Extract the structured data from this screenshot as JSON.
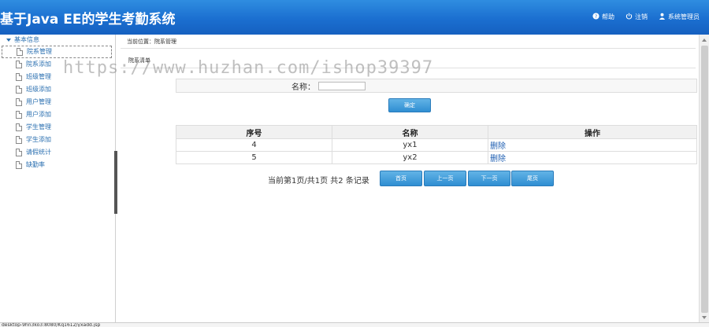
{
  "header": {
    "title": "基于Java EE的学生考勤系统",
    "nav": [
      {
        "label": "帮助",
        "icon": "help-icon"
      },
      {
        "label": "注销",
        "icon": "power-icon"
      },
      {
        "label": "系统管理员",
        "icon": "user-icon"
      }
    ]
  },
  "sidebar": {
    "section_label": "基本信息",
    "items": [
      {
        "label": "院系管理"
      },
      {
        "label": "院系添加"
      },
      {
        "label": "班级管理"
      },
      {
        "label": "班级添加"
      },
      {
        "label": "用户管理"
      },
      {
        "label": "用户添加"
      },
      {
        "label": "学生管理"
      },
      {
        "label": "学生添加"
      },
      {
        "label": "请假统计"
      },
      {
        "label": "缺勤率"
      }
    ]
  },
  "main": {
    "breadcrumb": "当前位置：院系管理",
    "list_tab": "院系清单",
    "search": {
      "label": "名称：",
      "value": ""
    },
    "confirm_label": "确定",
    "table": {
      "headers": [
        "序号",
        "名称",
        "操作"
      ],
      "rows": [
        {
          "id": "4",
          "name": "yx1",
          "op": "删除"
        },
        {
          "id": "5",
          "name": "yx2",
          "op": "删除"
        }
      ]
    },
    "pager": {
      "summary": "当前第1页/共1页  共2 条记录",
      "first": "首页",
      "prev": "上一页",
      "next": "下一页",
      "last": "尾页"
    }
  },
  "status_bar": "desktop-9hn3ko3:8080/Kq1612/yxadd.jsp",
  "watermark": "https://www.huzhan.com/ishop39397",
  "colors": {
    "header_blue": "#1b6fd0",
    "button_blue": "#2f8ed2",
    "link_blue": "#1f5fb2"
  }
}
